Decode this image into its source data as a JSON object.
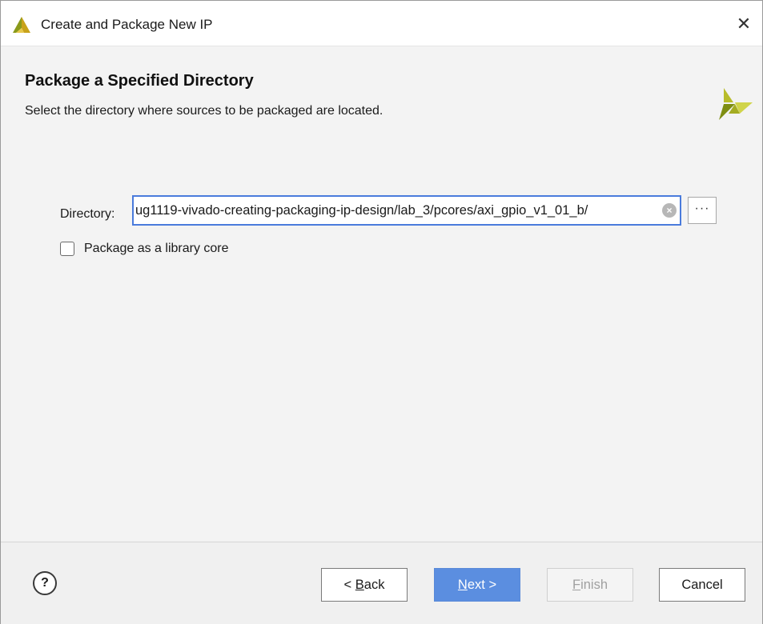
{
  "window": {
    "title": "Create and Package New IP",
    "close_glyph": "✕"
  },
  "page": {
    "heading": "Package a Specified Directory",
    "subheading": "Select the directory where sources to be packaged are located."
  },
  "form": {
    "directory_label": "Directory:",
    "directory_value": "/ug1119-vivado-creating-packaging-ip-design/lab_3/pcores/axi_gpio_v1_01_b",
    "browse_label": "···",
    "library_core_label": "Package as a library core",
    "library_core_checked": false
  },
  "footer": {
    "help_label": "?",
    "back_prefix": "< ",
    "back_mnemonic": "B",
    "back_rest": "ack",
    "next_mnemonic": "N",
    "next_rest": "ext >",
    "finish_mnemonic": "F",
    "finish_rest": "inish",
    "cancel_label": "Cancel"
  },
  "icons": {
    "app_logo": "xilinx-vivado-logo",
    "brand_logo": "xilinx-logo",
    "clear": "clear-circle-x-icon",
    "close": "close-icon"
  },
  "colors": {
    "accent": "#4a7bdc",
    "primary_button": "#5b8ee0",
    "logo_dark": "#8a9a1a",
    "logo_light": "#c8d03a"
  }
}
